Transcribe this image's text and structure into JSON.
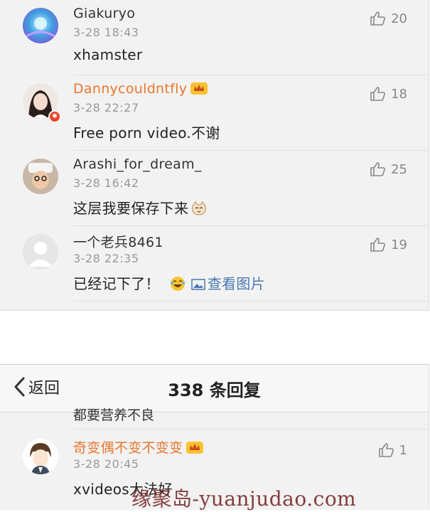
{
  "top_comments": [
    {
      "name": "Giakuryo",
      "vip": false,
      "time": "3-28 18:43",
      "text": "xhamster",
      "likes": "20"
    },
    {
      "name": "Dannycouldntfly",
      "vip": true,
      "time": "3-28 22:27",
      "text": "Free  porn video.不谢",
      "likes": "18"
    },
    {
      "name": "Arashi_for_dream_",
      "vip": false,
      "time": "3-28 16:42",
      "text": "这层我要保存下来",
      "likes": "25"
    },
    {
      "name": "一个老兵8461",
      "vip": false,
      "time": "3-28 22:35",
      "text": "已经记下了！",
      "view_image": "查看图片",
      "likes": "19"
    }
  ],
  "nav": {
    "back_label": "返回",
    "title": "338 条回复"
  },
  "partial_text": "都要营养不良",
  "bottom_comment": {
    "name": "奇变偶不变不变变",
    "vip": true,
    "time": "3-28 20:45",
    "text": "xvideos大法好",
    "likes": "1"
  },
  "watermark": "缘聚岛-yuanjudao.com",
  "colors": {
    "vip_name": "#e8772e",
    "link": "#4a79b3",
    "background": "#f2f2f2"
  }
}
